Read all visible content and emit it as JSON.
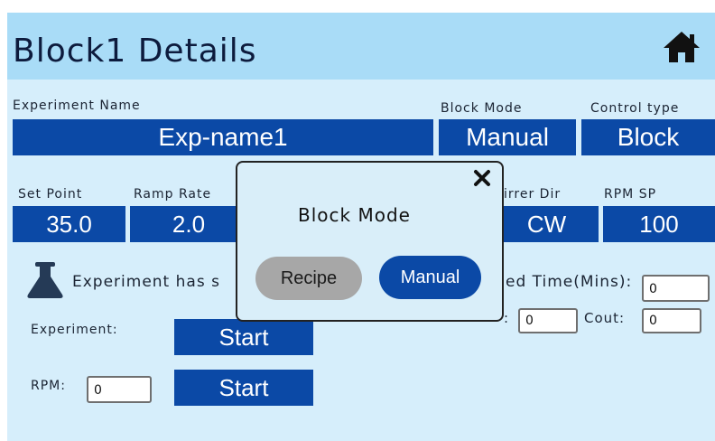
{
  "header": {
    "title": "Block1 Details",
    "home_icon": "home-icon"
  },
  "experiment_name": {
    "label": "Experiment Name",
    "value": "Exp-name1"
  },
  "block_mode": {
    "label": "Block Mode",
    "value": "Manual"
  },
  "control_type": {
    "label": "Control type",
    "value": "Block"
  },
  "set_point": {
    "label": "Set Point",
    "value": "35.0"
  },
  "ramp_rate": {
    "label": "Ramp Rate",
    "value": "2.0"
  },
  "stirrer_dir": {
    "label": "irrer Dir",
    "value": "CW"
  },
  "rpm_sp": {
    "label": "RPM SP",
    "value": "100"
  },
  "status": {
    "icon": "flask-icon",
    "text": "Experiment has s"
  },
  "elapsed": {
    "label": "ed Time(Mins):",
    "value": "0"
  },
  "cin": {
    "label": ":",
    "value": "0"
  },
  "cout": {
    "label": "Cout:",
    "value": "0"
  },
  "experiment_row": {
    "label": "Experiment:",
    "button": "Start"
  },
  "rpm_row": {
    "label": "RPM:",
    "value": "0",
    "button": "Start"
  },
  "modal": {
    "title": "Block Mode",
    "recipe": "Recipe",
    "manual": "Manual",
    "close_icon": "close-icon"
  },
  "colors": {
    "header_bg": "#a9dcf7",
    "panel_bg": "#d6eefb",
    "accent": "#0b49a6",
    "recipe_bg": "#a7a7a7"
  }
}
